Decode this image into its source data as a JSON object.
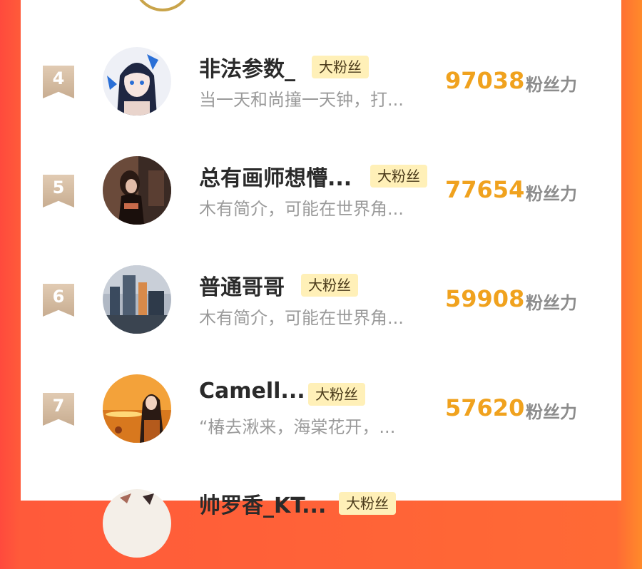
{
  "score_suffix": "粉丝力",
  "rows": [
    {
      "rank": "4",
      "name": "非法参数_",
      "tag": "大粉丝",
      "bio": "当一天和尚撞一天钟，打...",
      "score": "97038",
      "avatar_colors": [
        "#eef0f6",
        "#1f2742",
        "#2a6fd6"
      ]
    },
    {
      "rank": "5",
      "name": "总有画师想懵...",
      "tag": "大粉丝",
      "bio": "木有简介，可能在世界角...",
      "score": "77654",
      "avatar_colors": [
        "#6a4a3a",
        "#2a1a14",
        "#c86a4a"
      ]
    },
    {
      "rank": "6",
      "name": "普通哥哥",
      "tag": "大粉丝",
      "bio": "木有简介，可能在世界角...",
      "score": "59908",
      "avatar_colors": [
        "#b0b8c4",
        "#3a4a5e",
        "#d88a4a"
      ]
    },
    {
      "rank": "7",
      "name": "Camell...",
      "tag": "大粉丝",
      "bio": "“椿去湫来，海棠花开，...",
      "score": "57620",
      "avatar_colors": [
        "#f3a23a",
        "#b45a1c",
        "#2a1a14"
      ]
    },
    {
      "rank": "",
      "name": "帅罗香_KT...",
      "tag": "大粉丝",
      "bio": "",
      "score": "",
      "avatar_colors": [
        "#f4efe8",
        "#a86a5a",
        "#3a2a2a"
      ]
    }
  ]
}
